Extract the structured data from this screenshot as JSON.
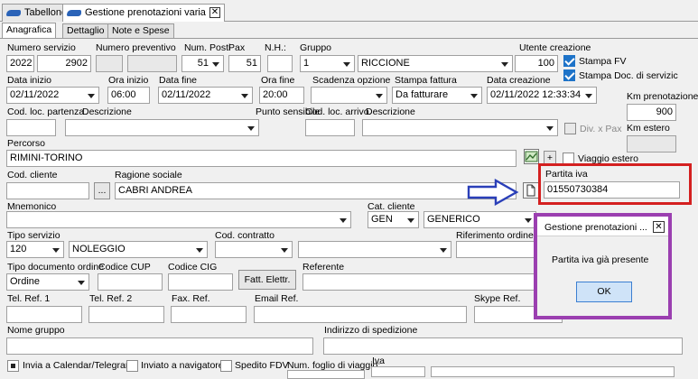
{
  "tabs": {
    "tab1": "Tabellone",
    "tab2": "Gestione prenotazioni varia",
    "close": "✕"
  },
  "subtabs": {
    "anagrafica": "Anagrafica",
    "dettaglio": "Dettaglio",
    "note": "Note e Spese"
  },
  "labels": {
    "numero_servizio": "Numero servizio",
    "numero_preventivo": "Numero preventivo",
    "num_posti": "Num. Posti",
    "pax": "Pax",
    "nh": "N.H.:",
    "gruppo": "Gruppo",
    "utente_creazione": "Utente creazione",
    "data_inizio": "Data inizio",
    "ora_inizio": "Ora inizio",
    "data_fine": "Data fine",
    "ora_fine": "Ora fine",
    "scadenza_opzione": "Scadenza opzione",
    "stampa_fattura": "Stampa fattura",
    "data_creazione": "Data creazione",
    "km_prenotazione": "Km prenotazione",
    "cod_loc_partenza": "Cod. loc. partenza",
    "descrizione1": "Descrizione",
    "punto_sensibile": "Punto sensibile",
    "cod_loc_arrivo": "Cod. loc. arrivo",
    "descrizione2": "Descrizione",
    "km_estero": "Km estero",
    "percorso": "Percorso",
    "cod_cliente": "Cod. cliente",
    "ragione_sociale": "Ragione sociale",
    "partita_iva": "Partita iva",
    "mnemonico": "Mnemonico",
    "cat_cliente": "Cat. cliente",
    "tipo_servizio": "Tipo servizio",
    "cod_contratto": "Cod. contratto",
    "riferimento_ordine": "Riferimento ordine clie",
    "tipo_documento": "Tipo documento ordine",
    "codice_cup": "Codice CUP",
    "codice_cig": "Codice CIG",
    "referente": "Referente",
    "tel1": "Tel. Ref. 1",
    "tel2": "Tel. Ref. 2",
    "fax": "Fax. Ref.",
    "email": "Email Ref.",
    "skype": "Skype Ref.",
    "nome_gruppo": "Nome gruppo",
    "indirizzo": "Indirizzo di spedizione",
    "num_foglio": "Num. foglio di viaggio:",
    "iva": "Iva"
  },
  "values": {
    "numero_servizio_anno": "2022",
    "numero_servizio_num": "2902",
    "num_posti": "51",
    "pax": "51",
    "gruppo_code": "1",
    "gruppo_name": "RICCIONE",
    "utente": "100",
    "data_inizio": "02/11/2022",
    "ora_inizio": "06:00",
    "data_fine": "02/11/2022",
    "ora_fine": "20:00",
    "stampa_fattura": "Da fatturare",
    "data_creazione": "02/11/2022 12:33:34",
    "km_prenotazione": "900",
    "percorso": "RIMINI-TORINO",
    "ragione_sociale": "CABRI ANDREA",
    "partita_iva": "01550730384",
    "cat_code": "GEN",
    "cat_name": "GENERICO",
    "tipo_servizio_code": "120",
    "tipo_servizio_name": "NOLEGGIO",
    "tipo_documento": "Ordine"
  },
  "checks": {
    "stampa_fv": "Stampa FV",
    "stampa_doc": "Stampa Doc. di servizic",
    "div_pax": "Div. x Pax",
    "viaggio_estero": "Viaggio estero",
    "invia_calendar": "Invia a Calendar/Telegram",
    "inviato_nav": "Inviato a navigatore",
    "spedito_fdv": "Spedito FDV"
  },
  "buttons": {
    "fatt_elettr": "Fatt. Elettr.",
    "ellipsis": "...",
    "plus": "+"
  },
  "dialog": {
    "title": "Gestione prenotazioni ...",
    "message": "Partita iva già presente",
    "ok": "OK",
    "close": "✕"
  },
  "colors": {
    "red_box": "#d42020",
    "purple_box": "#9b3fb0",
    "arrow": "#2a3fb8",
    "dialog_btn": "#cfe3f8"
  }
}
